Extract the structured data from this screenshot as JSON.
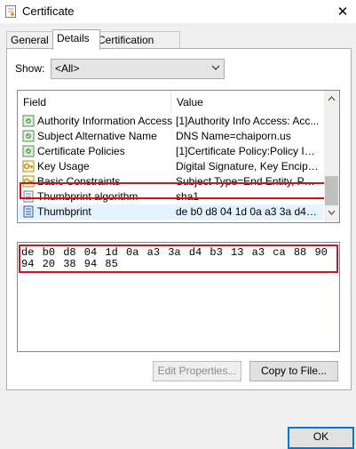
{
  "window": {
    "title": "Certificate",
    "close_symbol": "✕"
  },
  "tabs": [
    {
      "label": "General",
      "active": false
    },
    {
      "label": "Details",
      "active": true
    },
    {
      "label": "Certification Path",
      "active": false
    }
  ],
  "show": {
    "label": "Show:",
    "selected": "<All>"
  },
  "list": {
    "columns": {
      "field": "Field",
      "value": "Value"
    },
    "rows": [
      {
        "field": "Authority Information Access",
        "value": "[1]Authority Info Access: Acc...",
        "icon": "cert-extension-icon"
      },
      {
        "field": "Subject Alternative Name",
        "value": "DNS Name=chaiporn.us",
        "icon": "cert-extension-icon"
      },
      {
        "field": "Certificate Policies",
        "value": "[1]Certificate Policy:Policy Ide...",
        "icon": "cert-extension-icon"
      },
      {
        "field": "Key Usage",
        "value": "Digital Signature, Key Encipher...",
        "icon": "key-icon"
      },
      {
        "field": "Basic Constraints",
        "value": "Subject Type=End Entity, Pat...",
        "icon": "key-icon"
      },
      {
        "field": "Thumbprint algorithm",
        "value": "sha1",
        "icon": "document-icon"
      },
      {
        "field": "Thumbprint",
        "value": "de b0 d8 04 1d 0a a3 3a d4 b3...",
        "icon": "document-icon",
        "selected": true
      }
    ]
  },
  "value_text": "de b0 d8 04 1d 0a a3 3a d4 b3 13 a3 ca 88 90 94 20 38 94 85",
  "buttons": {
    "edit": "Edit Properties...",
    "copy": "Copy to File...",
    "ok": "OK"
  },
  "colors": {
    "highlight": "#d0141e",
    "accent": "#0078d7",
    "selection": "#e5f3ff"
  }
}
